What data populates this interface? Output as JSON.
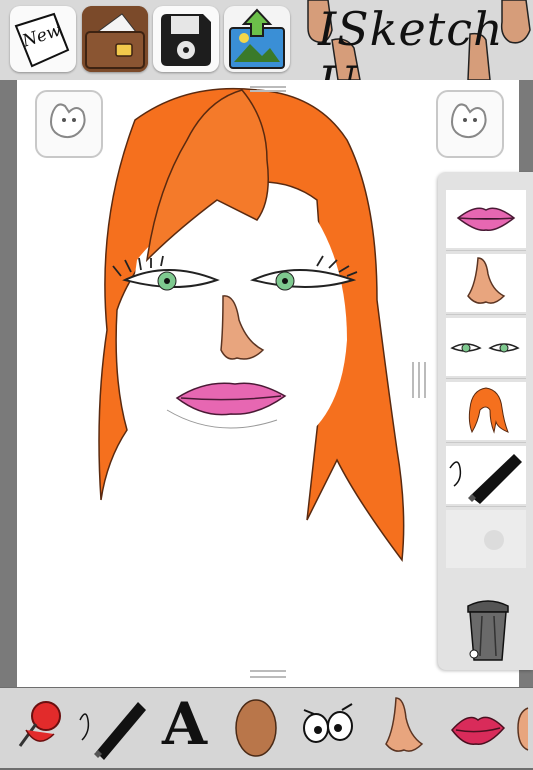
{
  "app": {
    "logo_text": "ISketch U"
  },
  "toolbar": {
    "new_label": "New",
    "buttons": [
      {
        "name": "new",
        "icon": "new-page-icon"
      },
      {
        "name": "open",
        "icon": "wallet-icon"
      },
      {
        "name": "save",
        "icon": "floppy-disk-icon"
      },
      {
        "name": "export",
        "icon": "photo-export-icon"
      }
    ]
  },
  "palette": {
    "items": [
      "lips-icon",
      "nose-icon",
      "eyes-icon",
      "hair-icon",
      "marker-icon",
      "empty-slot"
    ],
    "trash": "trash-can-icon"
  },
  "bottom_tools": [
    "pushpin-icon",
    "marker-icon",
    "text-icon",
    "face-shape-icon",
    "eyes-icon",
    "nose-icon",
    "lips-icon",
    "ear-icon"
  ],
  "bottom_text_tool_label": "A",
  "colors": {
    "hair": "#f5701e",
    "skin": "#e8a57e",
    "lips": "#e767b2",
    "iris": "#7ec98f",
    "toolbar": "#d9d9d9"
  }
}
